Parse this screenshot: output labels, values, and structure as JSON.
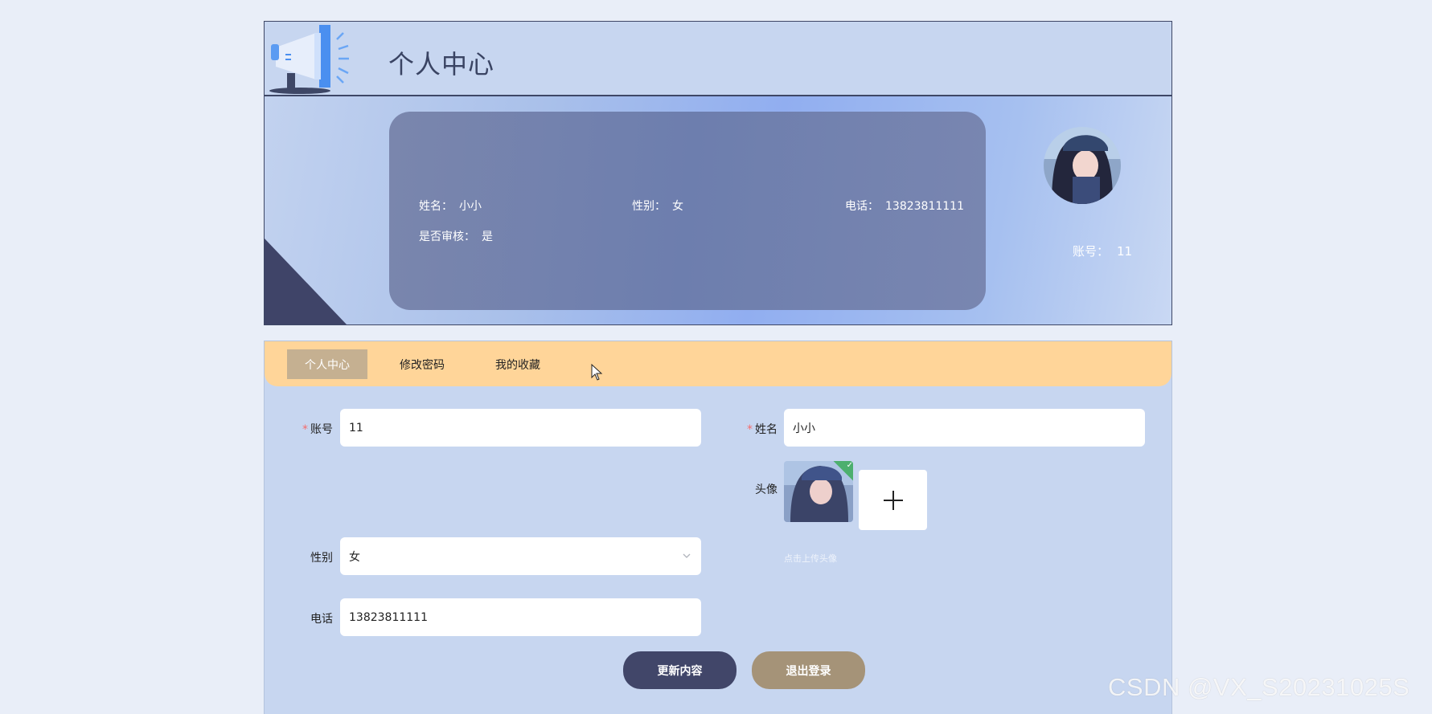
{
  "header": {
    "title": "个人中心",
    "logo_icon": "megaphone-icon"
  },
  "profile_card": {
    "name_label": "姓名：",
    "name_value": "小小",
    "gender_label": "性别：",
    "gender_value": "女",
    "phone_label": "电话：",
    "phone_value": "13823811111",
    "review_label": "是否审核：",
    "review_value": "是",
    "account_label": "账号：",
    "account_value": "11"
  },
  "tabs": [
    {
      "label": "个人中心",
      "active": true
    },
    {
      "label": "修改密码",
      "active": false
    },
    {
      "label": "我的收藏",
      "active": false
    }
  ],
  "form": {
    "account_label": "账号",
    "account_value": "11",
    "name_label": "姓名",
    "name_value": "小小",
    "avatar_label": "头像",
    "upload_tip": "点击上传头像",
    "gender_label": "性别",
    "gender_value": "女",
    "phone_label": "电话",
    "phone_value": "13823811111"
  },
  "buttons": {
    "update": "更新内容",
    "logout": "退出登录"
  },
  "watermark": "CSDN @VX_S20231025S",
  "colors": {
    "accent_dark": "#414669",
    "tab_bar": "#ffd599",
    "tab_active": "#c5b091",
    "logout_button": "#a59378",
    "panel_bg": "#c7d6f0"
  }
}
